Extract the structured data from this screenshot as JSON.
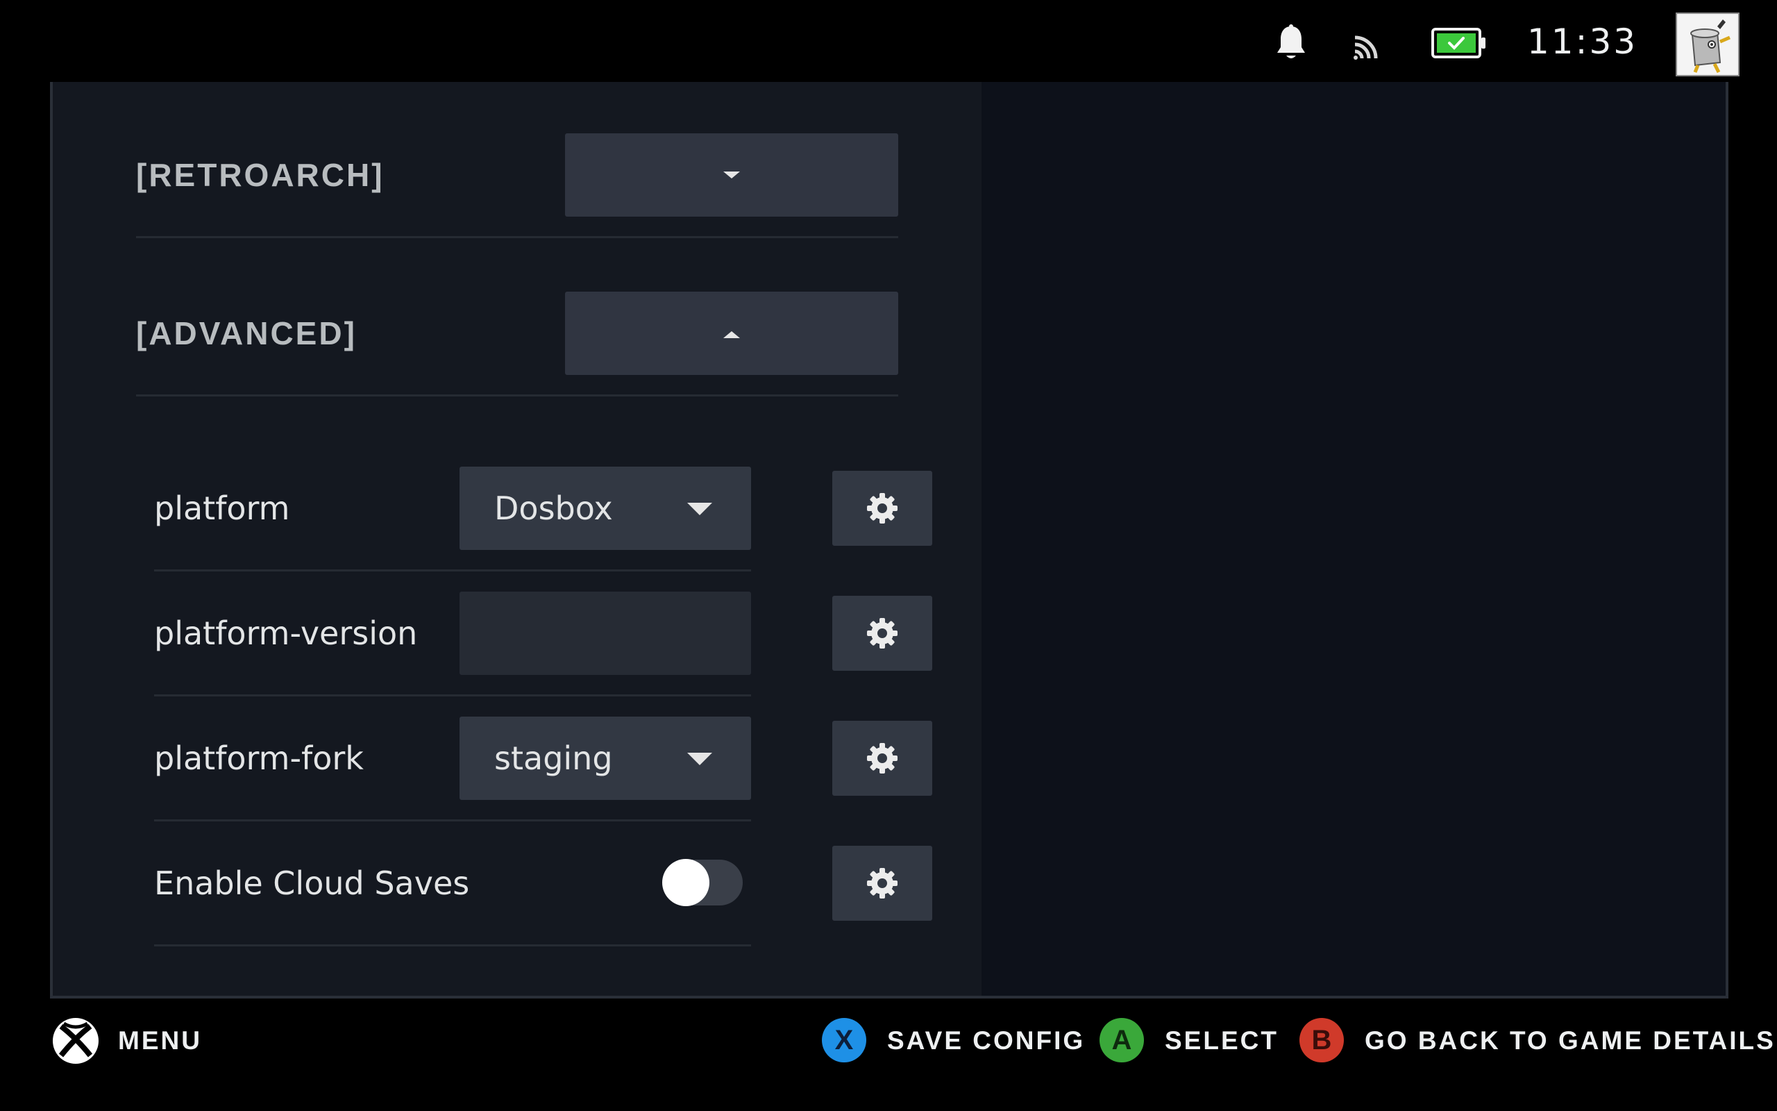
{
  "status_bar": {
    "time": "11:33",
    "icons": [
      "bell-icon",
      "cast-icon",
      "battery-icon"
    ],
    "battery_state": "charging",
    "battery_color": "#3cc83c"
  },
  "sections": {
    "retroarch": {
      "label": "[RETROARCH]",
      "expanded": false
    },
    "advanced": {
      "label": "[ADVANCED]",
      "expanded": true
    }
  },
  "settings": {
    "platform": {
      "label": "platform",
      "value": "Dosbox"
    },
    "platform_version": {
      "label": "platform-version",
      "value": ""
    },
    "platform_fork": {
      "label": "platform-fork",
      "value": "staging"
    },
    "cloud_saves": {
      "label": "Enable Cloud Saves",
      "enabled": false
    }
  },
  "footer": {
    "menu_label": "MENU",
    "x_glyph": "X",
    "x_label": "SAVE CONFIG",
    "x_color": "#1e90e6",
    "a_glyph": "A",
    "a_label": "SELECT",
    "a_color": "#3aa83a",
    "b_glyph": "B",
    "b_label": "GO BACK TO GAME DETAILS",
    "b_color": "#d03a2a"
  }
}
